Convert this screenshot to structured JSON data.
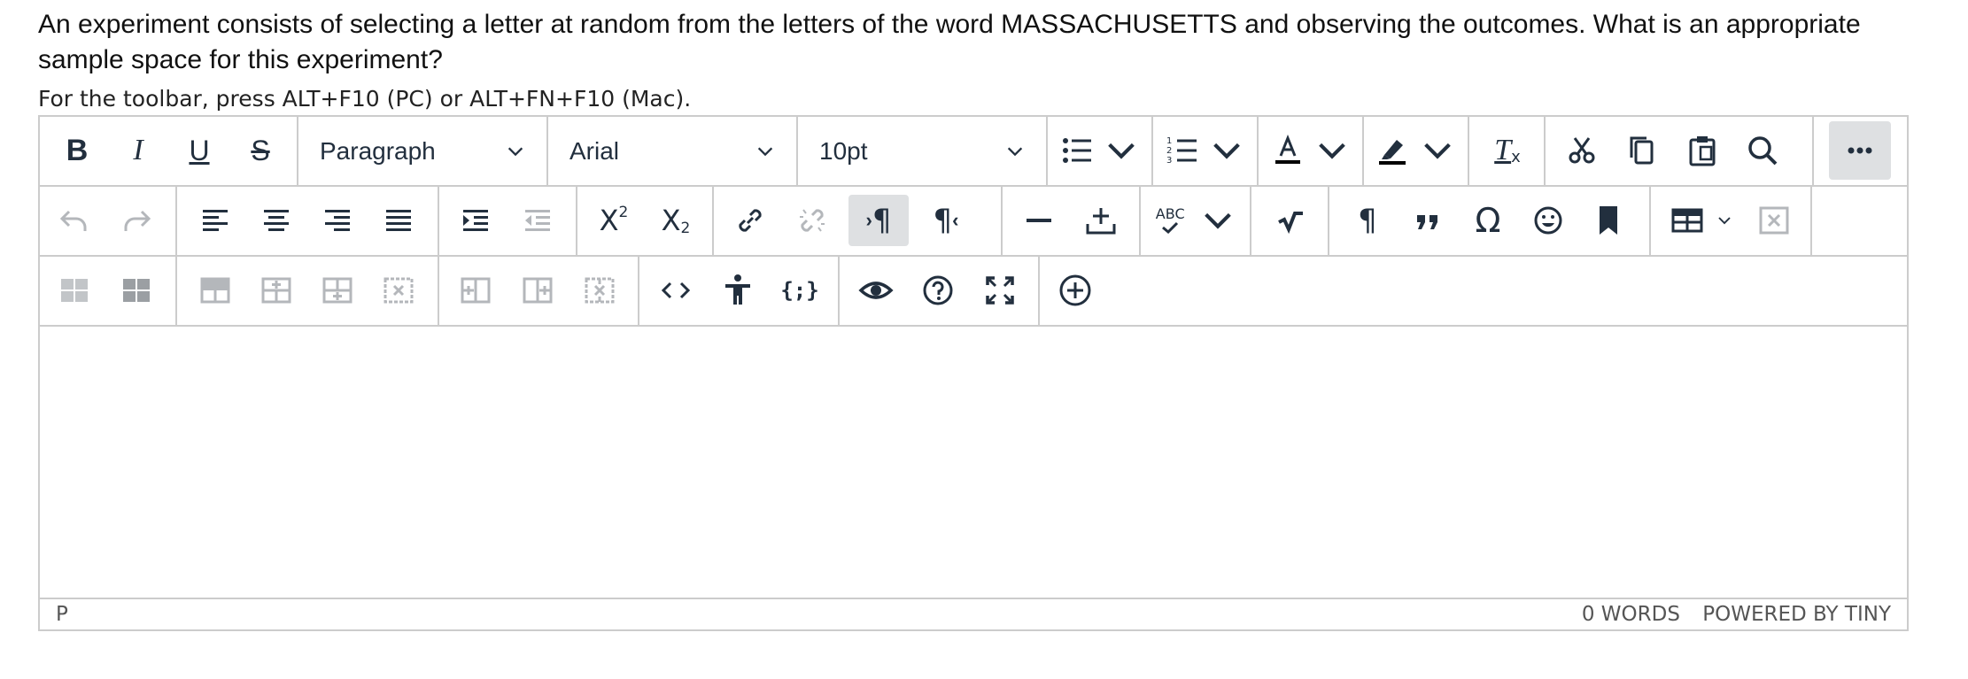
{
  "question": {
    "text": "An experiment consists of selecting a letter at random from the letters of the word MASSACHUSETTS and observing the outcomes.  What is an appropriate sample space for this experiment?"
  },
  "toolbar_hint": "For the toolbar, press ALT+F10 (PC) or ALT+FN+F10 (Mac).",
  "toolbar": {
    "bold": "B",
    "italic": "I",
    "underline": "U",
    "strikethrough": "S",
    "block_format": "Paragraph",
    "font_family": "Arial",
    "font_size": "10pt",
    "superscript_label": "X",
    "subscript_label": "X",
    "superscript_mark": "2",
    "subscript_mark": "2",
    "spellcheck_label": "ABC",
    "paragraph_mark": "¶",
    "omega": "Ω",
    "code_sample": "{;}",
    "clear_formatting": "T",
    "clear_formatting_mark": "x",
    "ltr_mark": "¶",
    "rtl_mark": "¶"
  },
  "statusbar": {
    "path": "P",
    "word_count": "0 WORDS",
    "branding": "POWERED BY TINY"
  },
  "colors": {
    "icon": "#222f3e",
    "border": "#cccccc",
    "active_bg": "#dee0e2",
    "disabled": "#b4b7bb"
  }
}
